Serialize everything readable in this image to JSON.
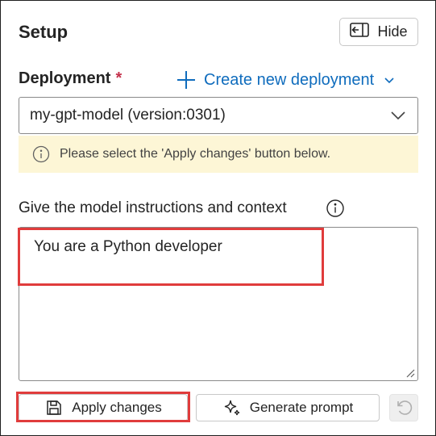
{
  "panel": {
    "title": "Setup",
    "hide_label": "Hide",
    "hide_icon": "panel-collapse-icon"
  },
  "deployment": {
    "label": "Deployment",
    "required_marker": "*",
    "create_link_label": "Create new deployment",
    "selected_value": "my-gpt-model (version:0301)",
    "warning_text": "Please select the 'Apply changes' button below."
  },
  "instructions": {
    "label": "Give the model instructions and context",
    "value": "You are a Python developer"
  },
  "actions": {
    "apply_label": "Apply changes",
    "generate_label": "Generate prompt",
    "undo_icon": "undo-icon"
  },
  "colors": {
    "accent": "#0f6cbd",
    "required": "#c4314b",
    "warning_bg": "#fdf6d6",
    "highlight": "#e03c3c"
  }
}
